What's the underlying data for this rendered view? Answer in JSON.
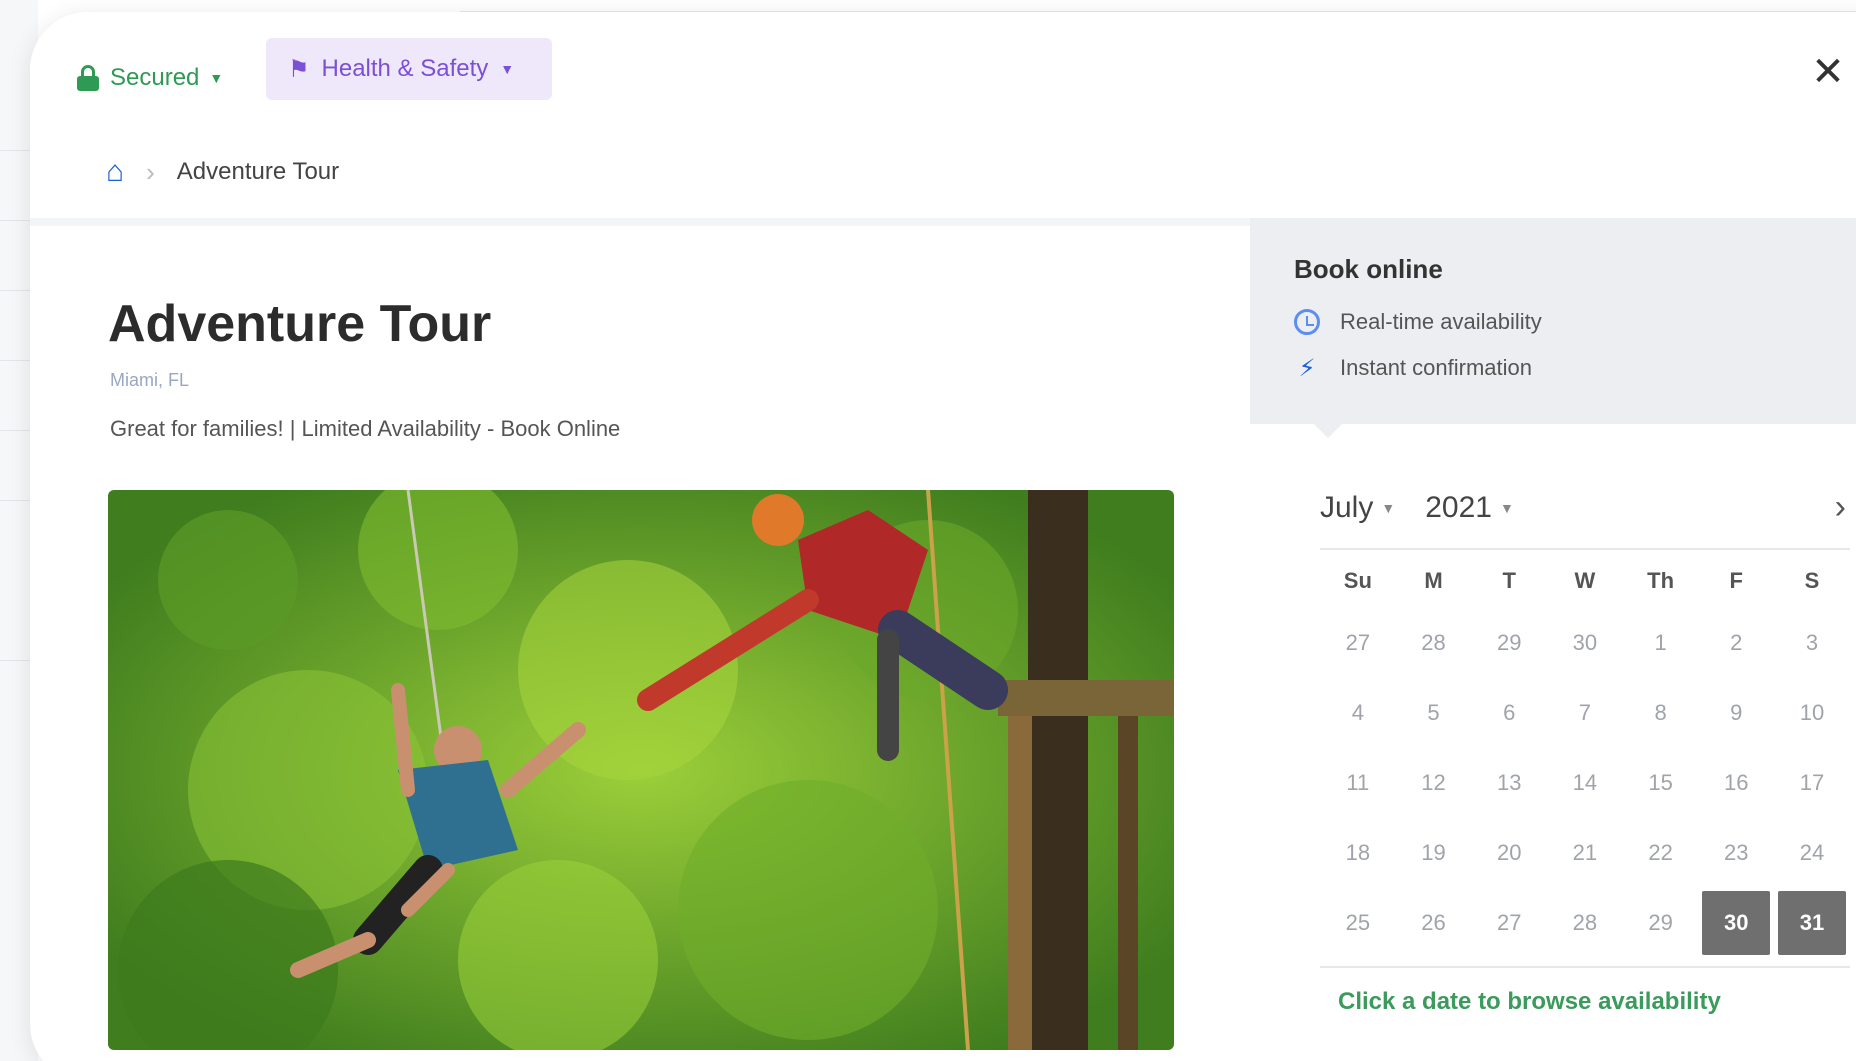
{
  "topbar": {
    "secured_label": "Secured",
    "health_label": "Health & Safety",
    "close_glyph": "✕"
  },
  "breadcrumb": {
    "current": "Adventure Tour"
  },
  "tour": {
    "title": "Adventure Tour",
    "location": "Miami, FL",
    "tagline": "Great for families! | Limited Availability - Book Online"
  },
  "booking": {
    "title": "Book online",
    "features": [
      "Real-time availability",
      "Instant confirmation"
    ]
  },
  "calendar": {
    "month": "July",
    "year": "2021",
    "weekdays": [
      "Su",
      "M",
      "T",
      "W",
      "Th",
      "F",
      "S"
    ],
    "weeks": [
      [
        "27",
        "28",
        "29",
        "30",
        "1",
        "2",
        "3"
      ],
      [
        "4",
        "5",
        "6",
        "7",
        "8",
        "9",
        "10"
      ],
      [
        "11",
        "12",
        "13",
        "14",
        "15",
        "16",
        "17"
      ],
      [
        "18",
        "19",
        "20",
        "21",
        "22",
        "23",
        "24"
      ],
      [
        "25",
        "26",
        "27",
        "28",
        "29",
        "30",
        "31"
      ]
    ],
    "selected": [
      "30",
      "31"
    ],
    "hint": "Click a date to browse availability"
  },
  "colors": {
    "secured_green": "#2e9a54",
    "health_purple": "#7b4fd6",
    "home_blue": "#1d5fd8",
    "selected_day": "#6f6f6f"
  }
}
